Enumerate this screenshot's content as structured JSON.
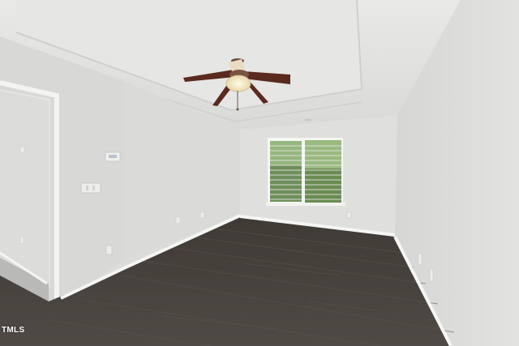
{
  "watermark": {
    "text": "TMLS"
  },
  "colors": {
    "ceiling": "#e6e6e4",
    "wall_back": "#dedede",
    "wall_left": "#d9d9d7",
    "wall_right": "#dcdcdc",
    "floor": "#4a4540",
    "trim": "#f4f4f2",
    "window_green": "#6d8f55",
    "fan_blade": "#5a2a1e"
  },
  "icons": {
    "ceiling_fan": "ceiling-fan-icon",
    "window": "window-icon",
    "thermostat": "thermostat-icon",
    "light_switch": "light-switch-icon",
    "outlet": "outlet-icon"
  }
}
